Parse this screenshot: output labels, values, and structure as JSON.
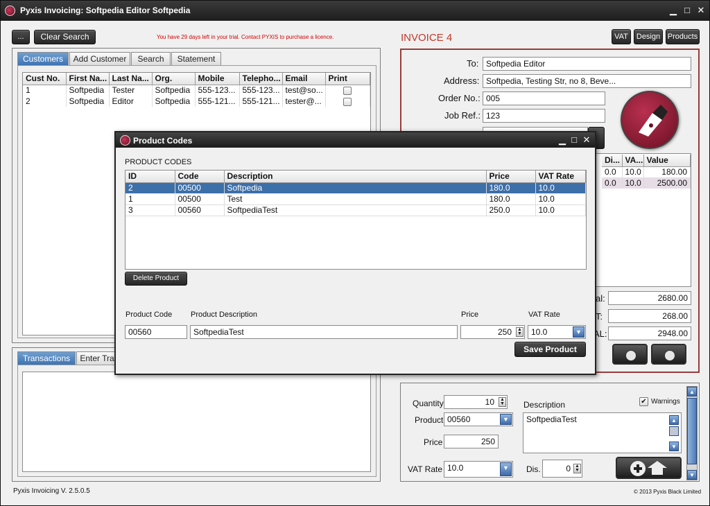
{
  "titlebar": {
    "title": "Pyxis Invoicing: Softpedia Editor Softpedia",
    "min": "▁",
    "max": "□",
    "close": "✕"
  },
  "toolbar": {
    "collapse_label": "...",
    "clear_search_label": "Clear Search",
    "trial_notice": "You have 29 days left in your trial. Contact PYXIS to purchase a licence."
  },
  "customers": {
    "tabs": [
      "Customers",
      "Add Customer",
      "Search",
      "Statement"
    ],
    "columns": [
      "Cust No.",
      "First Na...",
      "Last Na...",
      "Org.",
      "Mobile",
      "Telepho...",
      "Email",
      "Print"
    ],
    "rows": [
      {
        "cust_no": "1",
        "first": "Softpedia",
        "last": "Tester",
        "org": "Softpedia",
        "mobile": "555-123...",
        "phone": "555-123...",
        "email": "test@so..."
      },
      {
        "cust_no": "2",
        "first": "Softpedia",
        "last": "Editor",
        "org": "Softpedia",
        "mobile": "555-121...",
        "phone": "555-121...",
        "email": "tester@..."
      }
    ]
  },
  "transactions": {
    "tabs": [
      "Transactions",
      "Enter Tra"
    ]
  },
  "invoice": {
    "title": "INVOICE 4",
    "buttons": [
      "VAT",
      "Design",
      "Products"
    ],
    "to_label": "To:",
    "to_value": "Softpedia Editor",
    "address_label": "Address:",
    "address_value": "Softpedia, Testing Str, no 8, Beve...",
    "order_label": "Order No.:",
    "order_value": "005",
    "job_label": "Job Ref.:",
    "job_value": "123",
    "lines_columns": [
      "Di...",
      "VA...",
      "Value"
    ],
    "lines": [
      {
        "dis": "0.0",
        "vat": "10.0",
        "value": "180.00"
      },
      {
        "dis": "0.0",
        "vat": "10.0",
        "value": "2500.00"
      }
    ],
    "subtotal_label": "al:",
    "subtotal": "2680.00",
    "vat_label": "T:",
    "vat_total": "268.00",
    "total_label": "AL:",
    "total": "2948.00"
  },
  "line_entry": {
    "quantity_label": "Quantity",
    "quantity": "10",
    "product_label": "Product",
    "product": "00560",
    "price_label": "Price",
    "price": "250",
    "vatrate_label": "VAT Rate",
    "vatrate": "10.0",
    "dis_label": "Dis.",
    "dis": "0",
    "description_label": "Description",
    "description": "SoftpediaTest",
    "warnings_label": "Warnings"
  },
  "dialog": {
    "title": "Product Codes",
    "heading": "PRODUCT CODES",
    "columns": [
      "ID",
      "Code",
      "Description",
      "Price",
      "VAT Rate"
    ],
    "rows": [
      {
        "id": "2",
        "code": "00500",
        "desc": "Softpedia",
        "price": "180.0",
        "vat": "10.0"
      },
      {
        "id": "1",
        "code": "00500",
        "desc": "Test",
        "price": "180.0",
        "vat": "10.0"
      },
      {
        "id": "3",
        "code": "00560",
        "desc": "SoftpediaTest",
        "price": "250.0",
        "vat": "10.0"
      }
    ],
    "delete_label": "Delete Product",
    "code_label": "Product Code",
    "code_value": "00560",
    "desc_label": "Product Description",
    "desc_value": "SoftpediaTest",
    "price_label": "Price",
    "price_value": "250",
    "vat_label": "VAT Rate",
    "vat_value": "10.0",
    "save_label": "Save Product"
  },
  "statusbar": {
    "version": "Pyxis Invoicing V. 2.5.0.5",
    "copyright": "© 2013 Pyxis Black Limited"
  },
  "colors": {
    "accent": "#3e74b2",
    "brand": "#8b1a33",
    "invoice_title": "#c0392b"
  }
}
